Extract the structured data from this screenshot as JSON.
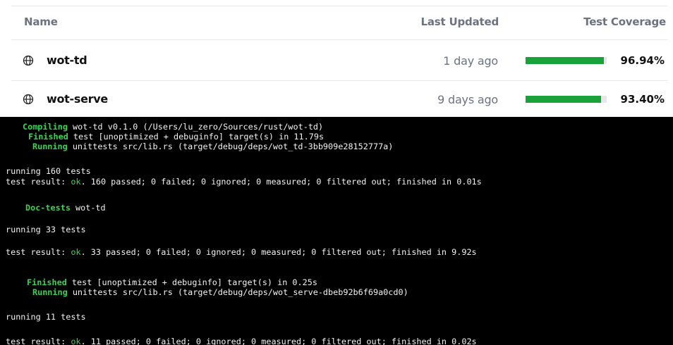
{
  "table": {
    "headers": {
      "name": "Name",
      "updated": "Last Updated",
      "coverage": "Test Coverage"
    },
    "rows": [
      {
        "name": "wot-td",
        "updated": "1 day ago",
        "coverage": "96.94%",
        "coverage_fraction": 0.9694,
        "icon": "globe-icon"
      },
      {
        "name": "wot-serve",
        "updated": "9 days ago",
        "coverage": "93.40%",
        "coverage_fraction": 0.934,
        "icon": "globe-icon"
      }
    ]
  },
  "colors": {
    "bar_fill": "#1aa23a",
    "bar_track": "#e5e7eb",
    "terminal_bg": "#000000",
    "terminal_green": "#39d353"
  },
  "terminal": {
    "l1_kw": "Compiling",
    "l1_rest": " wot-td v0.1.0 (/Users/lu_zero/Sources/rust/wot-td)",
    "l2_kw": "Finished",
    "l2_rest": " test [unoptimized + debuginfo] target(s) in 11.79s",
    "l3_kw": "Running",
    "l3_rest": " unittests src/lib.rs (target/debug/deps/wot_td-3bb909e28152777a)",
    "l4": "running 160 tests",
    "l5_pre": "test result: ",
    "l5_ok": "ok",
    "l5_rest": ". 160 passed; 0 failed; 0 ignored; 0 measured; 0 filtered out; finished in 0.01s",
    "l6_kw": "Doc-tests",
    "l6_rest": " wot-td",
    "l7": "running 33 tests",
    "l8_pre": "test result: ",
    "l8_ok": "ok",
    "l8_rest": ". 33 passed; 0 failed; 0 ignored; 0 measured; 0 filtered out; finished in 9.92s",
    "l9_kw": "Finished",
    "l9_rest": " test [unoptimized + debuginfo] target(s) in 0.25s",
    "l10_kw": "Running",
    "l10_rest": " unittests src/lib.rs (target/debug/deps/wot_serve-dbeb92b6f69a0cd0)",
    "l11": "running 11 tests",
    "l12_pre": "test result: ",
    "l12_ok": "ok",
    "l12_rest": ". 11 passed; 0 failed; 0 ignored; 0 measured; 0 filtered out; finished in 0.02s"
  }
}
